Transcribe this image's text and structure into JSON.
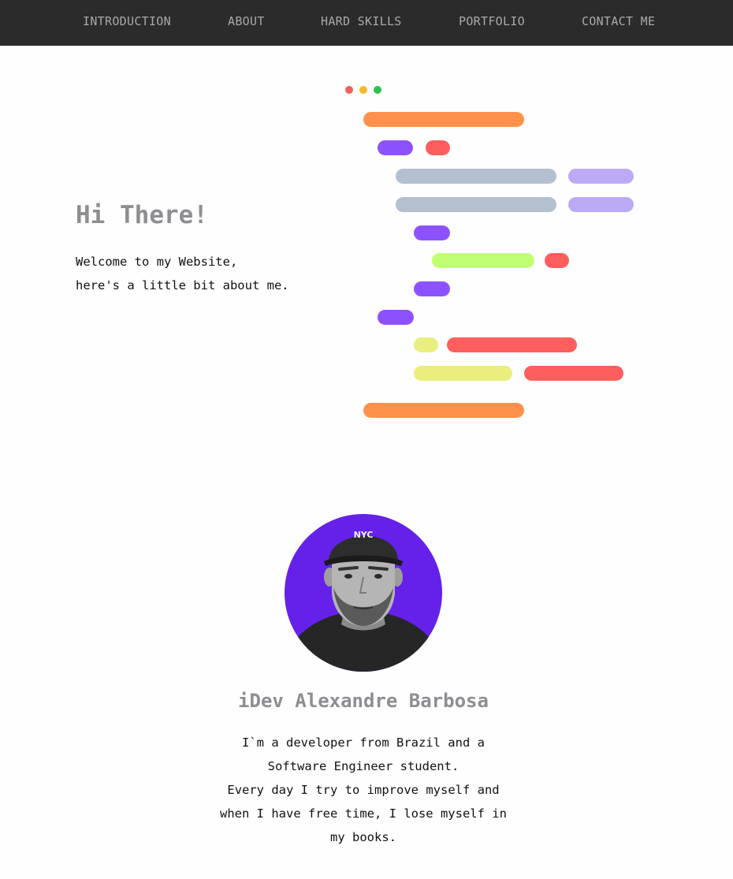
{
  "nav": {
    "items": [
      {
        "label": "INTRODUCTION"
      },
      {
        "label": "ABOUT"
      },
      {
        "label": "HARD SKILLS"
      },
      {
        "label": "PORTFOLIO"
      },
      {
        "label": "CONTACT ME"
      }
    ]
  },
  "hero": {
    "title": "Hi There!",
    "lines": [
      "Welcome to my Website,",
      "here's a little bit about me."
    ]
  },
  "code_illustration": {
    "window_dots": [
      "#f25f5c",
      "#f5b82e",
      "#2ec04f"
    ],
    "colors": {
      "orange": "#ff914d",
      "purple": "#8c52ff",
      "red": "#ff5e5e",
      "gray": "#b4bfd0",
      "lavender": "#bcaaf7",
      "lime": "#c1ff72",
      "yellow": "#eaee7e"
    }
  },
  "profile": {
    "name": "iDev Alexandre Barbosa",
    "cap_text": "NYC",
    "avatar_bg": "#6521ea",
    "bio_lines": [
      "I`m a developer from Brazil and a",
      "Software Engineer student.",
      "Every day I try to improve myself and",
      "when I have free time, I lose myself in",
      "my books."
    ]
  }
}
